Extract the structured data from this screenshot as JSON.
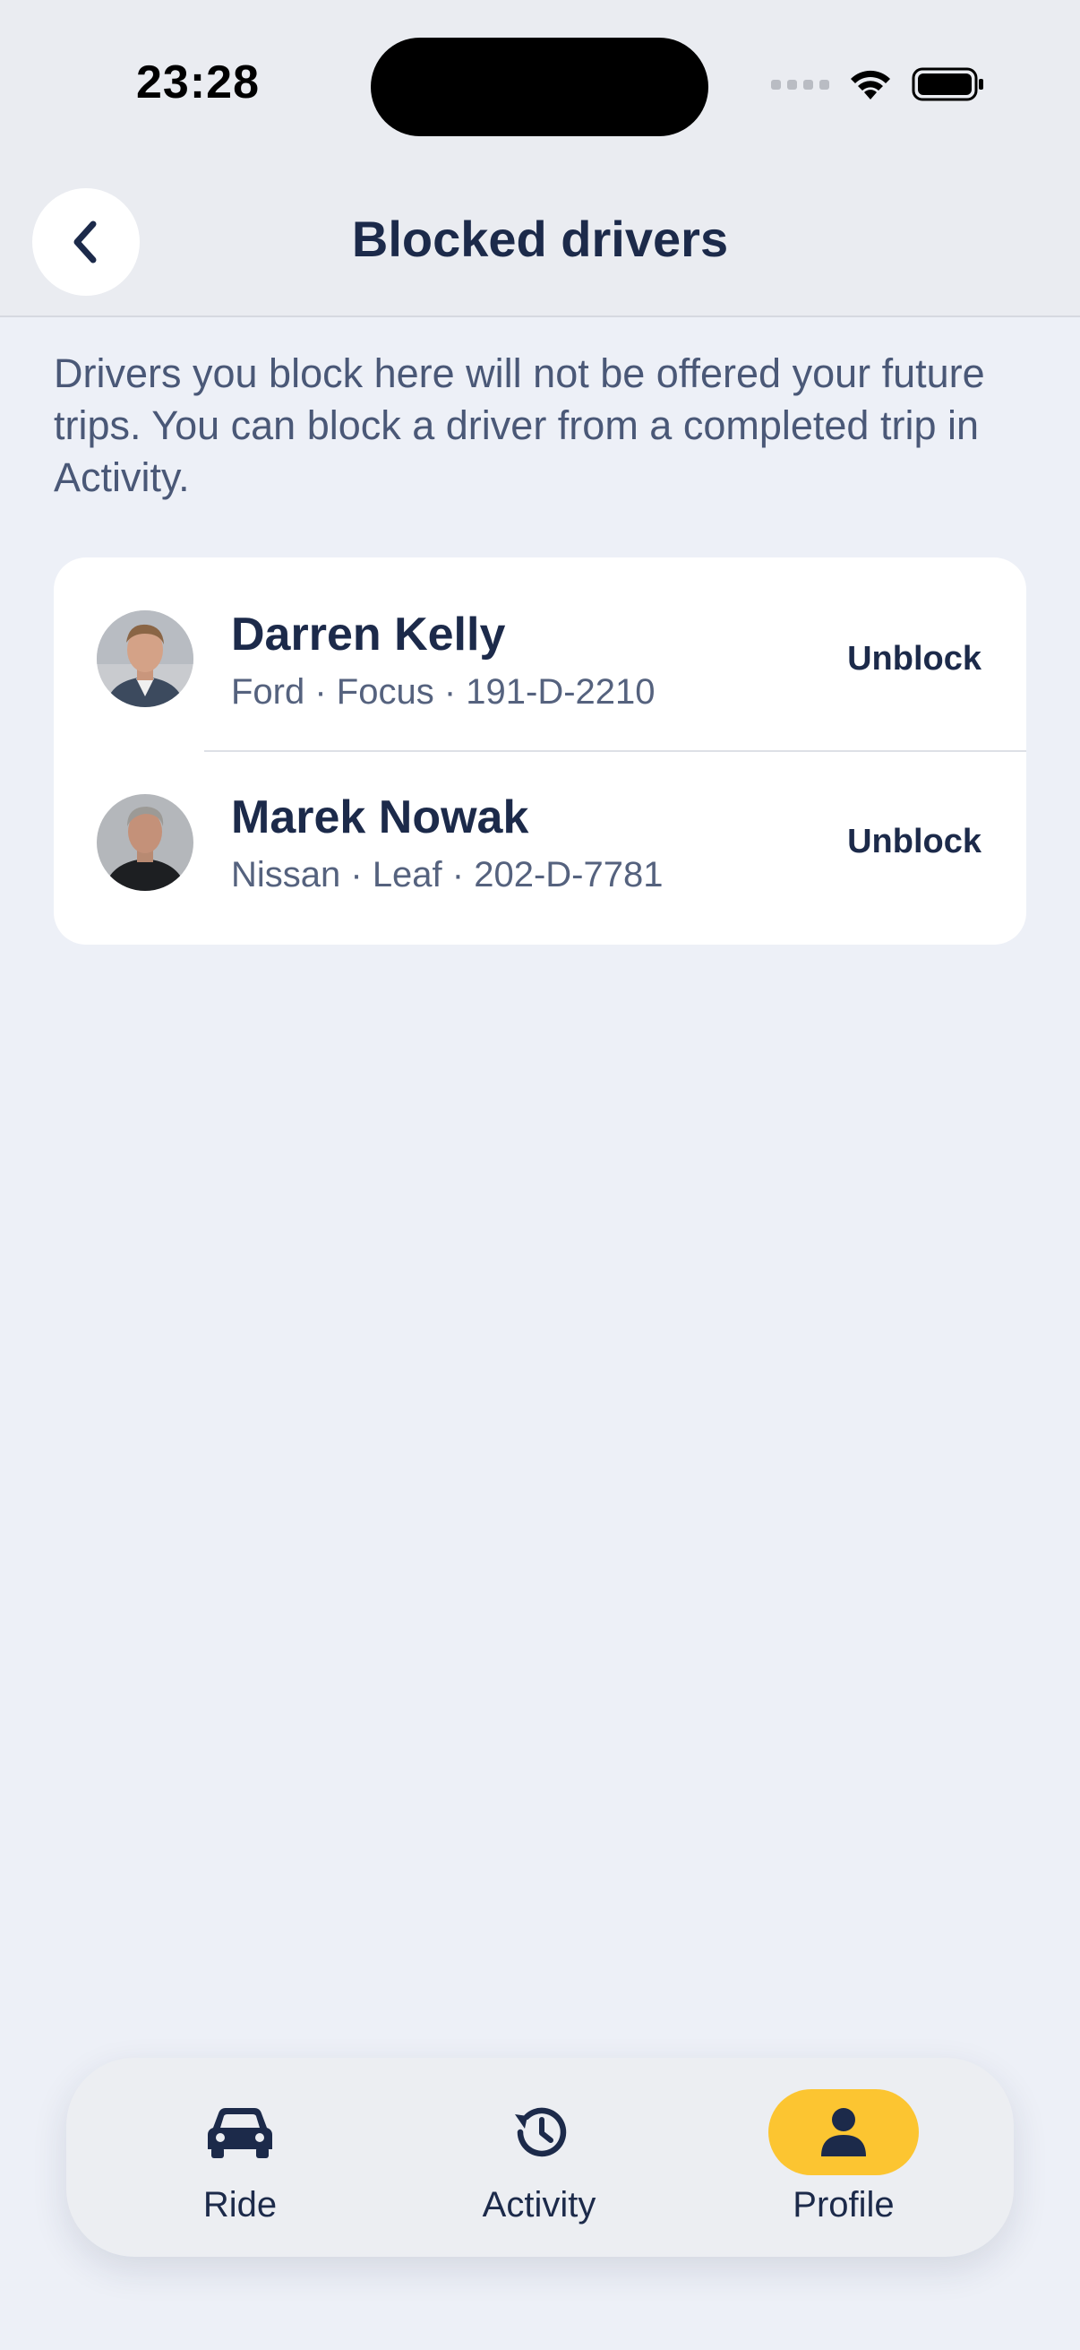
{
  "status_bar": {
    "time": "23:28"
  },
  "header": {
    "back_icon": "chevron-left-icon",
    "title": "Blocked drivers"
  },
  "intro": {
    "text": "Drivers you block here will not be offered your future trips. You can block a driver from a completed trip in Activity."
  },
  "blocked_drivers": [
    {
      "name": "Darren Kelly",
      "vehicle": "Ford · Focus · 191-D-2210",
      "action_label": "Unblock"
    },
    {
      "name": "Marek Nowak",
      "vehicle": "Nissan · Leaf · 202-D-7781",
      "action_label": "Unblock"
    }
  ],
  "tab_bar": {
    "active": "Profile",
    "active_color": "#fcc531",
    "tabs": [
      {
        "label": "Ride",
        "icon": "car-icon"
      },
      {
        "label": "Activity",
        "icon": "history-icon"
      },
      {
        "label": "Profile",
        "icon": "person-icon"
      }
    ]
  }
}
